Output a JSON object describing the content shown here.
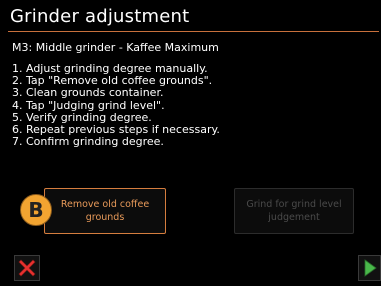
{
  "header": {
    "title": "Grinder adjustment"
  },
  "subtitle": "M3: Middle grinder  - Kaffee Maximum",
  "steps": [
    "1. Adjust grinding degree manually.",
    "2. Tap \"Remove old coffee grounds\".",
    "3. Clean grounds container.",
    "4. Tap \"Judging grind level\".",
    "5. Verify grinding degree.",
    "6. Repeat previous steps if necessary.",
    "7. Confirm grinding degree."
  ],
  "actions": {
    "badge_label": "B",
    "remove_label": "Remove old coffee grounds",
    "grind_label": "Grind for grind level judgement"
  },
  "footer": {
    "cancel_icon": "close-icon",
    "next_icon": "play-icon"
  },
  "colors": {
    "accent": "#d57d3e",
    "badge": "#f2a431",
    "cancel": "#e8312f",
    "next": "#49b84a",
    "background": "#000000"
  }
}
